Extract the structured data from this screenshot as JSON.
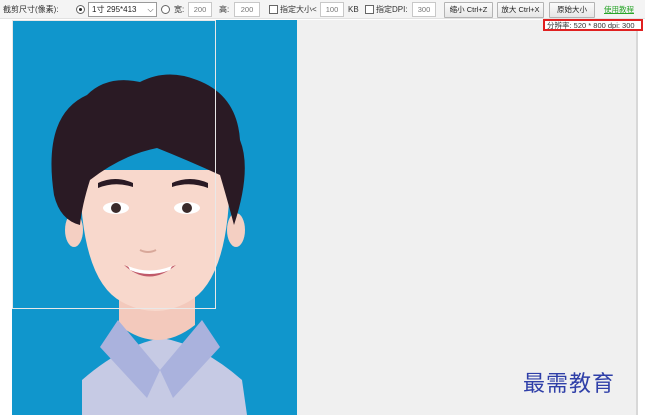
{
  "toolbar": {
    "crop_size_label": "截剪尺寸(像素):",
    "preset_value": "1寸 295*413",
    "width_label": "宽:",
    "width_value": "200",
    "height_label": "高:",
    "height_value": "200",
    "size_limit_label": "指定大小<",
    "size_limit_value": "100",
    "size_unit": "KB",
    "dpi_label": "指定DPI:",
    "dpi_value": "300",
    "zoom_out_label": "缩小 Ctrl+Z",
    "zoom_in_label": "放大 Ctrl+X",
    "original_size_label": "原始大小",
    "help_link": "使用教程"
  },
  "status": {
    "resolution": "分辨率: 520 * 800 dpi: 300"
  },
  "watermark": "最需教育",
  "colors": {
    "photo_background": "#1096cc",
    "hair": "#2a1a24",
    "skin": "#f8d8cc",
    "shirt": "#c6cae4",
    "collar": "#aab2dd",
    "status_border": "#e02020",
    "link": "#2aa52a",
    "watermark": "#2f3fa8"
  }
}
